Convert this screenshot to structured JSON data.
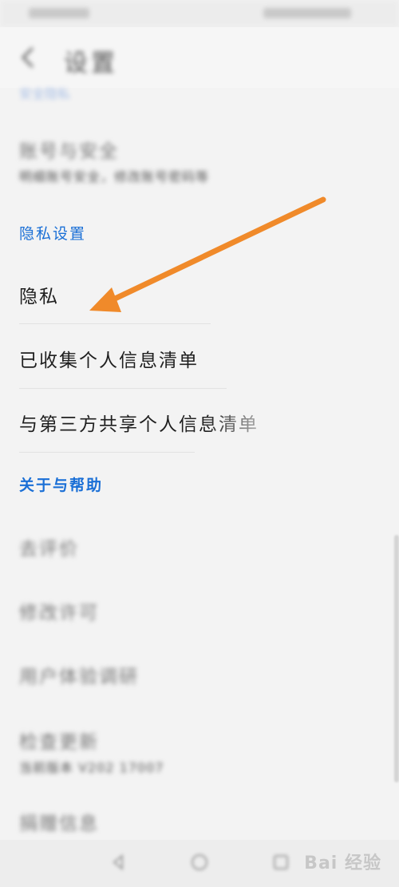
{
  "header": {
    "title": "设置",
    "back_icon": "chevron-left-icon"
  },
  "top_section": {
    "label": "安全隐私"
  },
  "items_top": [
    {
      "title": "账号与安全",
      "subtitle": "明细账号安全，修改账号密码等"
    }
  ],
  "privacy_section": {
    "label": "隐私设置",
    "items": [
      {
        "title": "隐私"
      },
      {
        "title": "已收集个人信息清单"
      },
      {
        "title": "与第三方共享个人信息清单"
      }
    ]
  },
  "help_section": {
    "label": "关于与帮助",
    "items": [
      {
        "title": "去评价"
      },
      {
        "title": "修改许可"
      },
      {
        "title": "用户体验调研"
      },
      {
        "title": "检查更新",
        "subtitle": "当前版本 V202 17007"
      },
      {
        "title": "捐赠信息"
      }
    ]
  },
  "nav": {
    "back": "back-icon",
    "home": "home-icon",
    "recent": "recent-icon"
  },
  "watermark": "Bai 经验",
  "colors": {
    "accent": "#1a6fd6",
    "arrow": "#f08a2a"
  }
}
